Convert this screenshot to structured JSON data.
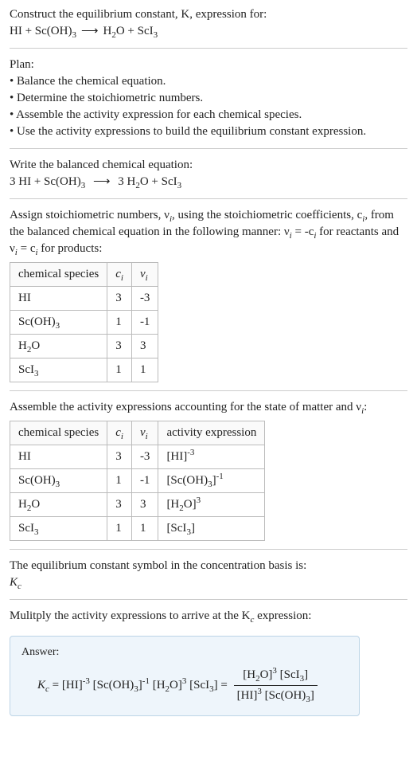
{
  "prompt": {
    "line1": "Construct the equilibrium constant, K, expression for:",
    "eq_lhs_a": "HI + Sc(OH)",
    "eq_lhs_a_sub": "3",
    "arrow": "⟶",
    "eq_rhs_a": "H",
    "eq_rhs_a_sub1": "2",
    "eq_rhs_a2": "O + ScI",
    "eq_rhs_a_sub2": "3"
  },
  "plan": {
    "title": "Plan:",
    "b1": "• Balance the chemical equation.",
    "b2": "• Determine the stoichiometric numbers.",
    "b3": "• Assemble the activity expression for each chemical species.",
    "b4": "• Use the activity expressions to build the equilibrium constant expression."
  },
  "balanced": {
    "title": "Write the balanced chemical equation:",
    "lhs1": "3 HI + Sc(OH)",
    "lhs1_sub": "3",
    "arrow": "⟶",
    "rhs1": "3 H",
    "rhs1_sub1": "2",
    "rhs2": "O + ScI",
    "rhs2_sub": "3"
  },
  "assign": {
    "text_a": "Assign stoichiometric numbers, ν",
    "text_a_sub": "i",
    "text_b": ", using the stoichiometric coefficients, c",
    "text_b_sub": "i",
    "text_c": ", from the balanced chemical equation in the following manner: ν",
    "text_c_sub": "i",
    "text_d": " = -c",
    "text_d_sub": "i",
    "text_e": " for reactants and ν",
    "text_e_sub": "i",
    "text_f": " = c",
    "text_f_sub": "i",
    "text_g": " for products:"
  },
  "table1": {
    "h1": "chemical species",
    "h2_a": "c",
    "h2_sub": "i",
    "h3_a": "ν",
    "h3_sub": "i",
    "rows": [
      {
        "sp_a": "HI",
        "sp_sub": "",
        "c": "3",
        "v": "-3"
      },
      {
        "sp_a": "Sc(OH)",
        "sp_sub": "3",
        "c": "1",
        "v": "-1"
      },
      {
        "sp_a": "H",
        "sp_mid": "2",
        "sp_b": "O",
        "c": "3",
        "v": "3"
      },
      {
        "sp_a": "ScI",
        "sp_sub": "3",
        "c": "1",
        "v": "1"
      }
    ]
  },
  "assemble": {
    "text_a": "Assemble the activity expressions accounting for the state of matter and ν",
    "text_a_sub": "i",
    "text_b": ":"
  },
  "table2": {
    "h1": "chemical species",
    "h2_a": "c",
    "h2_sub": "i",
    "h3_a": "ν",
    "h3_sub": "i",
    "h4": "activity expression",
    "rows": [
      {
        "sp_a": "HI",
        "c": "3",
        "v": "-3",
        "ae_a": "[HI]",
        "ae_sup": "-3"
      },
      {
        "sp_a": "Sc(OH)",
        "sp_sub": "3",
        "c": "1",
        "v": "-1",
        "ae_a": "[Sc(OH)",
        "ae_sub": "3",
        "ae_b": "]",
        "ae_sup": "-1"
      },
      {
        "sp_a": "H",
        "sp_mid": "2",
        "sp_b": "O",
        "c": "3",
        "v": "3",
        "ae_a": "[H",
        "ae_sub": "2",
        "ae_b": "O]",
        "ae_sup": "3"
      },
      {
        "sp_a": "ScI",
        "sp_sub": "3",
        "c": "1",
        "v": "1",
        "ae_a": "[ScI",
        "ae_sub": "3",
        "ae_b": "]"
      }
    ]
  },
  "symbol": {
    "line1": "The equilibrium constant symbol in the concentration basis is:",
    "k": "K",
    "k_sub": "c"
  },
  "multiply": {
    "text_a": "Mulitply the activity expressions to arrive at the K",
    "text_a_sub": "c",
    "text_b": " expression:"
  },
  "answer": {
    "label": "Answer:",
    "k": "K",
    "k_sub": "c",
    "eq": " = ",
    "t1": "[HI]",
    "t1_sup": "-3",
    "t2a": " [Sc(OH)",
    "t2_sub": "3",
    "t2b": "]",
    "t2_sup": "-1",
    "t3a": " [H",
    "t3_sub": "2",
    "t3b": "O]",
    "t3_sup": "3",
    "t4a": " [ScI",
    "t4_sub": "3",
    "t4b": "] = ",
    "num_a": "[H",
    "num_sub1": "2",
    "num_b": "O]",
    "num_sup1": "3",
    "num_c": " [ScI",
    "num_sub2": "3",
    "num_d": "]",
    "den_a": "[HI]",
    "den_sup1": "3",
    "den_b": " [Sc(OH)",
    "den_sub1": "3",
    "den_c": "]"
  }
}
